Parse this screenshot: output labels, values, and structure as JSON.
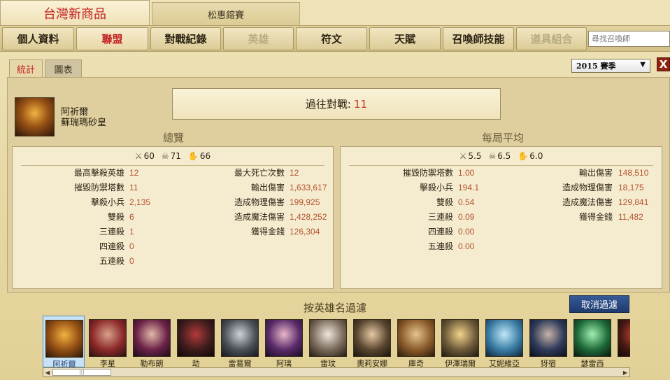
{
  "tabs": {
    "active": "台灣新商品",
    "inactive": "松惠鎔賽"
  },
  "nav": {
    "items": [
      "個人資料",
      "聯盟",
      "對戰紀錄",
      "英雄",
      "符文",
      "天賦",
      "召喚師技能",
      "道具組合"
    ],
    "search_placeholder": "尋找召喚師"
  },
  "subtabs": [
    "統計",
    "圖表"
  ],
  "season": {
    "selected": "2015 賽季",
    "arrow": "▼"
  },
  "close_label": "X",
  "champion": {
    "name": "阿祈爾",
    "title": "蘇瑞瑪砂皇"
  },
  "past_matches": {
    "label": "過往對戰:",
    "value": "11"
  },
  "overview": {
    "heading": "總覽",
    "kills": "60",
    "deaths": "71",
    "assists": "66",
    "left": [
      {
        "label": "最高擊殺英雄",
        "value": "12"
      },
      {
        "label": "摧毀防禦塔數",
        "value": "11"
      },
      {
        "label": "擊殺小兵",
        "value": "2,135"
      },
      {
        "label": "雙殺",
        "value": "6"
      },
      {
        "label": "三連殺",
        "value": "1"
      },
      {
        "label": "四連殺",
        "value": "0"
      },
      {
        "label": "五連殺",
        "value": "0"
      }
    ],
    "right": [
      {
        "label": "最大死亡次數",
        "value": "12"
      },
      {
        "label": "輸出傷害",
        "value": "1,633,617"
      },
      {
        "label": "造成物理傷害",
        "value": "199,925"
      },
      {
        "label": "造成魔法傷害",
        "value": "1,428,252"
      },
      {
        "label": "獲得金錢",
        "value": "126,304"
      }
    ]
  },
  "average": {
    "heading": "每局平均",
    "kills": "5.5",
    "deaths": "6.5",
    "assists": "6.0",
    "left": [
      {
        "label": "摧毀防禦塔數",
        "value": "1.00"
      },
      {
        "label": "擊殺小兵",
        "value": "194.1"
      },
      {
        "label": "雙殺",
        "value": "0.54"
      },
      {
        "label": "三連殺",
        "value": "0.09"
      },
      {
        "label": "四連殺",
        "value": "0.00"
      },
      {
        "label": "五連殺",
        "value": "0.00"
      }
    ],
    "right": [
      {
        "label": "輸出傷害",
        "value": "148,510"
      },
      {
        "label": "造成物理傷害",
        "value": "18,175"
      },
      {
        "label": "造成魔法傷害",
        "value": "129,841"
      },
      {
        "label": "獲得金錢",
        "value": "11,482"
      }
    ]
  },
  "filter": {
    "title": "按英雄名過濾",
    "clear_label": "取消過濾",
    "champions": [
      "阿祈爾",
      "李星",
      "勒布朗",
      "劫",
      "雷葛爾",
      "阿璃",
      "雷玟",
      "奧莉安娜",
      "庫奇",
      "伊澤瑞爾",
      "艾妮維亞",
      "犽宿",
      "瑟雷西",
      ""
    ]
  },
  "scrollbar": {
    "left": "◀",
    "right": "▶",
    "grip": "|||"
  },
  "colors": {
    "value_text": "#b4532e",
    "accent_red": "#c21e1e",
    "clear_button": "#1f3a6e"
  }
}
